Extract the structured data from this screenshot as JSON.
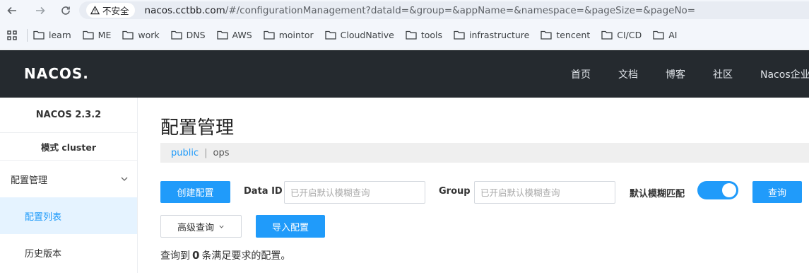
{
  "browser": {
    "insecure_label": "不安全",
    "url_domain": "nacos.cctbb.com",
    "url_rest": "/#/configurationManagement?dataId=&group=&appName=&namespace=&pageSize=&pageNo="
  },
  "bookmarks": [
    "learn",
    "ME",
    "work",
    "DNS",
    "AWS",
    "mointor",
    "CloudNative",
    "tools",
    "infrastructure",
    "tencent",
    "CI/CD",
    "AI"
  ],
  "header": {
    "logo": "NACOS.",
    "links": [
      "首页",
      "文档",
      "博客",
      "社区",
      "Nacos企业"
    ]
  },
  "sidebar": {
    "version": "NACOS 2.3.2",
    "mode": "模式 cluster",
    "group_label": "配置管理",
    "items": [
      "配置列表",
      "历史版本"
    ]
  },
  "main": {
    "title": "配置管理",
    "namespaces": [
      "public",
      "ops"
    ],
    "create_button": "创建配置",
    "data_id_label": "Data ID",
    "data_id_placeholder": "已开启默认模糊查询",
    "group_label": "Group",
    "group_placeholder": "已开启默认模糊查询",
    "fuzzy_label": "默认模糊匹配",
    "fuzzy_enabled": true,
    "search_button": "查询",
    "advanced_button": "高级查询",
    "import_button": "导入配置",
    "result_prefix": "查询到",
    "result_count": "0",
    "result_suffix": "条满足要求的配置。"
  },
  "colors": {
    "accent": "#209bfa",
    "header_bg": "#252a2f",
    "active_item_bg": "#e5f3ff"
  }
}
